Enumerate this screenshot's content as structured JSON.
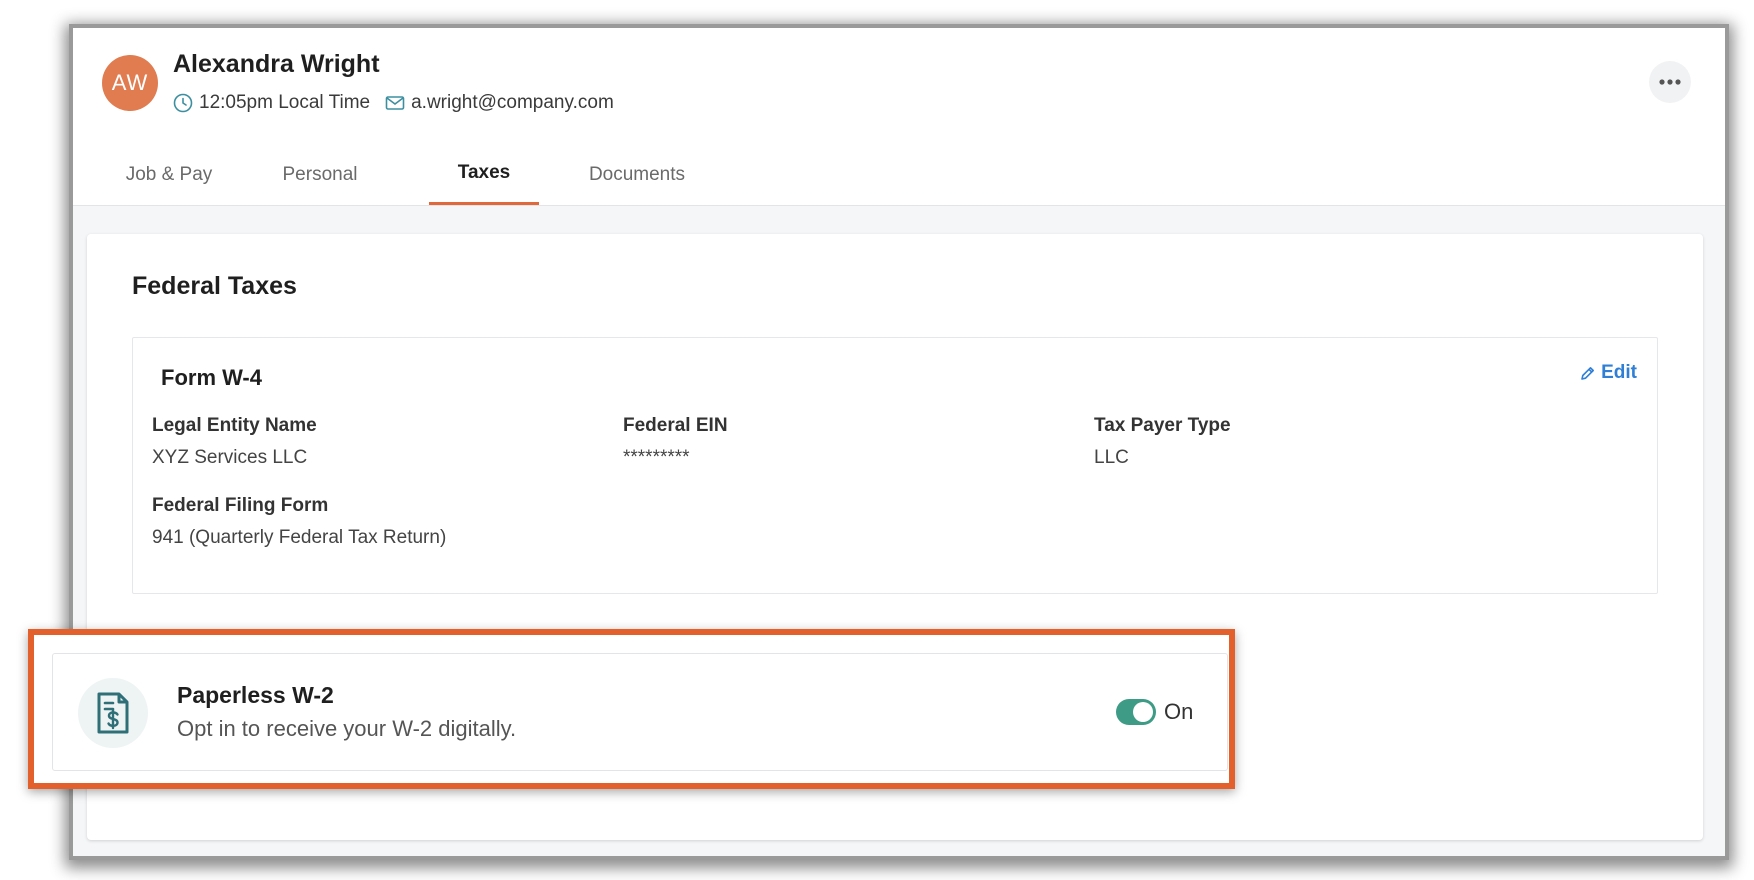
{
  "user": {
    "initials": "AW",
    "name": "Alexandra Wright",
    "local_time": "12:05pm Local Time",
    "email": "a.wright@company.com"
  },
  "tabs": [
    {
      "label": "Job & Pay"
    },
    {
      "label": "Personal"
    },
    {
      "label": "Taxes"
    },
    {
      "label": "Documents"
    }
  ],
  "active_tab": "Taxes",
  "federal": {
    "title": "Federal Taxes",
    "form": {
      "title": "Form W-4",
      "edit_label": "Edit",
      "fields": [
        {
          "label": "Legal Entity Name",
          "value": "XYZ Services LLC"
        },
        {
          "label": "Federal EIN",
          "value": "*********"
        },
        {
          "label": "Tax Payer Type",
          "value": "LLC"
        },
        {
          "label": "Federal Filing Form",
          "value": "941 (Quarterly Federal Tax Return)"
        }
      ]
    }
  },
  "paperless": {
    "title": "Paperless W-2",
    "description": "Opt in to receive your W-2 digitally.",
    "toggle_label": "On",
    "enabled": true
  },
  "colors": {
    "avatar": "#e07c4f",
    "accent": "#e0683b",
    "highlight_border": "#e35f2b",
    "link": "#2f7fd6",
    "toggle_on": "#3d9b86",
    "icon_teal": "#2e6f78"
  },
  "icons": [
    "clock-icon",
    "mail-icon",
    "more-icon",
    "pencil-icon",
    "document-dollar-icon"
  ]
}
